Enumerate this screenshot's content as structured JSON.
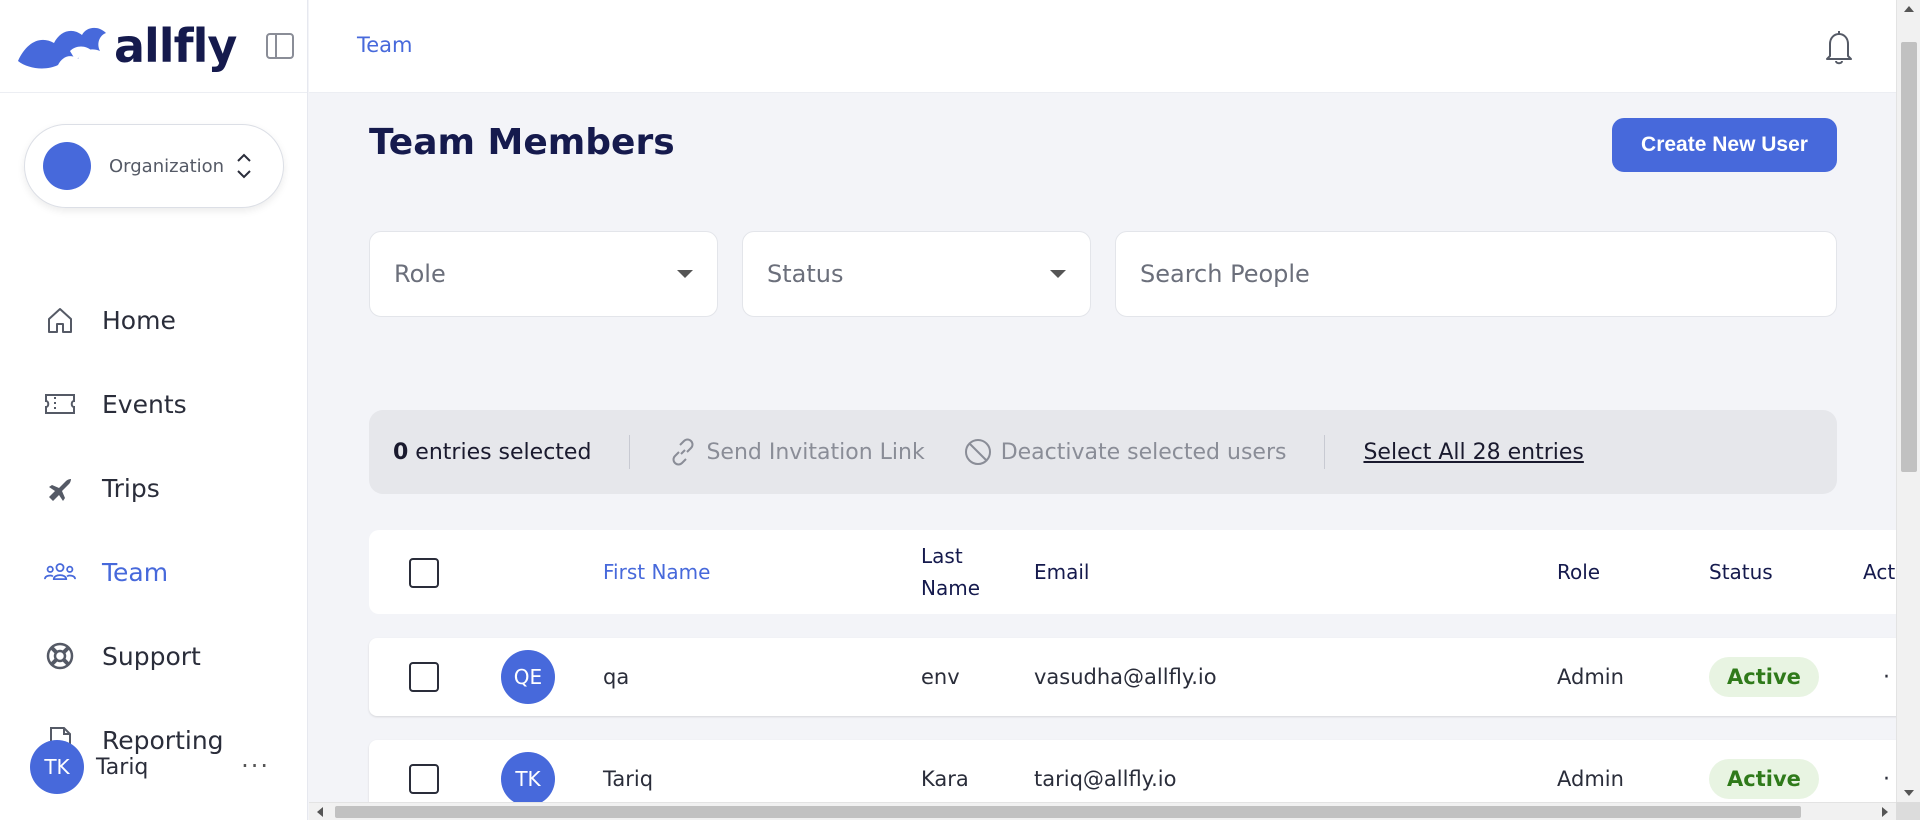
{
  "brand": {
    "name": "allfly",
    "color": "#4769db",
    "dark": "#151a4d"
  },
  "organization": {
    "label": "Organization"
  },
  "nav": [
    {
      "label": "Home",
      "icon": "home-icon"
    },
    {
      "label": "Events",
      "icon": "ticket-icon"
    },
    {
      "label": "Trips",
      "icon": "airplane-icon"
    },
    {
      "label": "Team",
      "icon": "team-icon",
      "active": true
    },
    {
      "label": "Support",
      "icon": "lifebuoy-icon"
    },
    {
      "label": "Reporting",
      "icon": "document-icon"
    }
  ],
  "user": {
    "initials": "TK",
    "name": "Tariq"
  },
  "topbar": {
    "breadcrumb": "Team"
  },
  "page": {
    "title": "Team Members",
    "create_button": "Create New User"
  },
  "filters": {
    "role": "Role",
    "status": "Status",
    "search_placeholder": "Search People"
  },
  "bulk": {
    "count": "0",
    "count_suffix": " entries selected",
    "send_invite": "Send Invitation Link",
    "deactivate": "Deactivate selected users",
    "select_all": "Select All 28 entries"
  },
  "table": {
    "headers": {
      "first_name": "First Name",
      "last_name_1": "Last",
      "last_name_2": "Name",
      "email": "Email",
      "role": "Role",
      "status": "Status",
      "actions": "Act"
    },
    "rows": [
      {
        "initials": "QE",
        "first": "qa",
        "last": "env",
        "email": "vasudha@allfly.io",
        "role": "Admin",
        "status": "Active"
      },
      {
        "initials": "TK",
        "first": "Tariq",
        "last": "Kara",
        "email": "tariq@allfly.io",
        "role": "Admin",
        "status": "Active"
      }
    ]
  }
}
